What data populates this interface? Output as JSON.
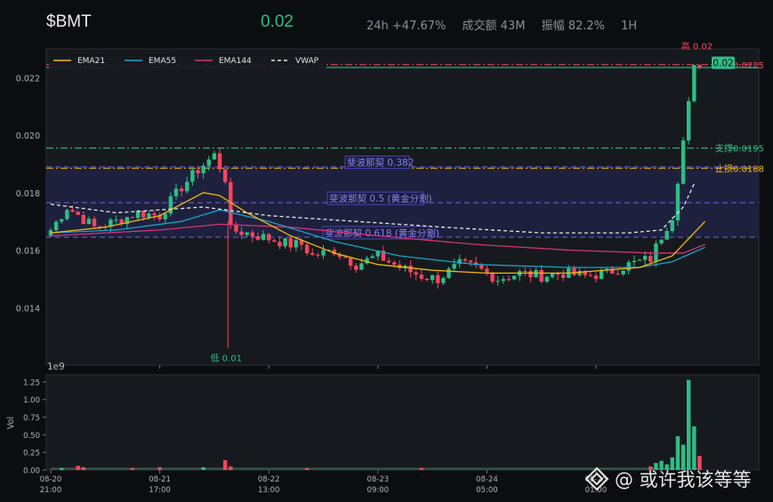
{
  "header": {
    "symbol": "$BMT",
    "price": "0.02",
    "change": "24h +47.67%",
    "volume": "成交额 43M",
    "amplitude": "振幅 82.2%",
    "interval": "1H"
  },
  "watermark": "@ 或许我该等等",
  "colors": {
    "up": "#2ebd85",
    "down": "#f6465d",
    "ema21": "#f0b90b",
    "ema55": "#18a2c9",
    "ema144": "#d2337c",
    "vwap": "#ffffff",
    "fib": "#6a5acd"
  },
  "chart_data": [
    {
      "type": "candlestick",
      "legend": [
        "EMA21",
        "EMA55",
        "EMA144",
        "VWAP"
      ],
      "legend_position": "top-left",
      "grid": false,
      "ylim": [
        0.012,
        0.023
      ],
      "yticks": [
        "0.014",
        "0.016",
        "0.018",
        "0.020",
        "0.022"
      ],
      "xticks": [
        {
          "t": 0,
          "label": [
            "08-20",
            "21:00"
          ]
        },
        {
          "t": 20,
          "label": [
            "08-21",
            "17:00"
          ]
        },
        {
          "t": 40,
          "label": [
            "08-22",
            "13:00"
          ]
        },
        {
          "t": 60,
          "label": [
            "08-23",
            "09:00"
          ]
        },
        {
          "t": 80,
          "label": [
            "08-24",
            "05:00"
          ]
        },
        {
          "t": 100,
          "label": [
            "08-25",
            "01:00"
          ]
        }
      ],
      "levels": [
        {
          "value": 0.02245,
          "label": "阻力0.0225",
          "color": "#f6465d",
          "style": "dashdot"
        },
        {
          "value": 0.02235,
          "label": "",
          "color": "#2ebd85",
          "style": "solid"
        },
        {
          "value": 0.01955,
          "label": "支撑0.0195",
          "color": "#2ebd85",
          "style": "dashdot"
        },
        {
          "value": 0.01885,
          "label": "止损0.0188",
          "color": "#f0b90b",
          "style": "dashdot"
        },
        {
          "value": 0.0189,
          "label": "斐波那契 0.382",
          "color": "#6a5acd",
          "style": "dash"
        },
        {
          "value": 0.01765,
          "label": "斐波那契 0.5 (黄金分割)",
          "color": "#6a5acd",
          "style": "dash"
        },
        {
          "value": 0.01645,
          "label": "斐波那契 0.618 (黄金分割)",
          "color": "#6a5acd",
          "style": "dash"
        }
      ],
      "annotations": {
        "high": {
          "t": 118.5,
          "value": 0.0228,
          "label": "高 0.02"
        },
        "low": {
          "t": 32.5,
          "value": 0.0126,
          "label": "低 0.01"
        },
        "last_price": {
          "value": 0.02255,
          "label": "0.02"
        }
      },
      "candle_keys": [
        [
          0,
          0.0167,
          3
        ],
        [
          3,
          0.0175,
          1
        ],
        [
          8,
          0.0168,
          2
        ],
        [
          12,
          0.017,
          2
        ],
        [
          16,
          0.0173,
          3
        ],
        [
          20,
          0.0172,
          2
        ],
        [
          24,
          0.0182,
          3
        ],
        [
          27,
          0.0188,
          3
        ],
        [
          30,
          0.0193,
          4
        ],
        [
          32,
          0.0185,
          6
        ],
        [
          33,
          0.0167,
          3
        ],
        [
          36,
          0.0166,
          2
        ],
        [
          40,
          0.0164,
          2
        ],
        [
          44,
          0.0162,
          2
        ],
        [
          46,
          0.0162,
          2
        ],
        [
          48,
          0.0158,
          3
        ],
        [
          52,
          0.016,
          2
        ],
        [
          56,
          0.0155,
          2
        ],
        [
          60,
          0.0158,
          2
        ],
        [
          64,
          0.0154,
          2
        ],
        [
          68,
          0.0151,
          3
        ],
        [
          71,
          0.015,
          2
        ],
        [
          75,
          0.0155,
          2
        ],
        [
          78,
          0.0154,
          2
        ],
        [
          82,
          0.015,
          2
        ],
        [
          86,
          0.0152,
          2
        ],
        [
          90,
          0.0151,
          2
        ],
        [
          94,
          0.0152,
          2
        ],
        [
          98,
          0.0151,
          2
        ],
        [
          102,
          0.0152,
          2
        ],
        [
          106,
          0.0155,
          2
        ],
        [
          110,
          0.0157,
          3
        ],
        [
          112,
          0.0165,
          4
        ],
        [
          114,
          0.0172,
          5
        ],
        [
          116,
          0.0198,
          8
        ],
        [
          118,
          0.0223,
          6
        ],
        [
          119,
          0.0225,
          4
        ]
      ],
      "ema21": [
        [
          0,
          0.0166
        ],
        [
          10,
          0.0168
        ],
        [
          20,
          0.0172
        ],
        [
          28,
          0.018
        ],
        [
          31,
          0.0179
        ],
        [
          36,
          0.0173
        ],
        [
          44,
          0.0165
        ],
        [
          52,
          0.0159
        ],
        [
          60,
          0.0155
        ],
        [
          70,
          0.0153
        ],
        [
          80,
          0.0152
        ],
        [
          95,
          0.0152
        ],
        [
          108,
          0.0154
        ],
        [
          114,
          0.0158
        ],
        [
          120,
          0.017
        ]
      ],
      "ema55": [
        [
          0,
          0.0166
        ],
        [
          12,
          0.0167
        ],
        [
          24,
          0.017
        ],
        [
          31,
          0.0174
        ],
        [
          40,
          0.017
        ],
        [
          52,
          0.0163
        ],
        [
          64,
          0.0158
        ],
        [
          78,
          0.0155
        ],
        [
          95,
          0.0154
        ],
        [
          108,
          0.0154
        ],
        [
          114,
          0.0156
        ],
        [
          120,
          0.0161
        ]
      ],
      "ema144": [
        [
          0,
          0.0165
        ],
        [
          20,
          0.0167
        ],
        [
          31,
          0.0169
        ],
        [
          44,
          0.0168
        ],
        [
          60,
          0.0165
        ],
        [
          78,
          0.0162
        ],
        [
          95,
          0.016
        ],
        [
          110,
          0.0159
        ],
        [
          116,
          0.0159
        ],
        [
          120,
          0.0162
        ]
      ],
      "vwap": [
        [
          0,
          0.0176
        ],
        [
          12,
          0.0173
        ],
        [
          28,
          0.0175
        ],
        [
          32,
          0.0174
        ],
        [
          40,
          0.0172
        ],
        [
          56,
          0.017
        ],
        [
          72,
          0.0168
        ],
        [
          90,
          0.0166
        ],
        [
          106,
          0.0166
        ],
        [
          112,
          0.0167
        ],
        [
          116,
          0.0175
        ],
        [
          118,
          0.0183
        ]
      ]
    },
    {
      "type": "bar",
      "ylabel": "Vol",
      "scale_label": "1e9",
      "ylim": [
        0,
        1.35
      ],
      "yticks": [
        "0.00",
        "0.25",
        "0.50",
        "0.75",
        "1.00",
        "1.25"
      ],
      "volumes": [
        {
          "t": 2,
          "value": 0.03
        },
        {
          "t": 5,
          "value": 0.06
        },
        {
          "t": 6,
          "value": 0.04
        },
        {
          "t": 15,
          "value": 0.03
        },
        {
          "t": 20,
          "value": 0.04
        },
        {
          "t": 28,
          "value": 0.04
        },
        {
          "t": 32,
          "value": 0.14
        },
        {
          "t": 33,
          "value": 0.05
        },
        {
          "t": 47,
          "value": 0.03
        },
        {
          "t": 68,
          "value": 0.03
        },
        {
          "t": 110,
          "value": 0.05
        },
        {
          "t": 111,
          "value": 0.1
        },
        {
          "t": 112,
          "value": 0.13
        },
        {
          "t": 113,
          "value": 0.08
        },
        {
          "t": 114,
          "value": 0.18
        },
        {
          "t": 115,
          "value": 0.48
        },
        {
          "t": 116,
          "value": 0.36
        },
        {
          "t": 117,
          "value": 1.28
        },
        {
          "t": 118,
          "value": 0.62
        },
        {
          "t": 119,
          "value": 0.2
        }
      ]
    }
  ]
}
